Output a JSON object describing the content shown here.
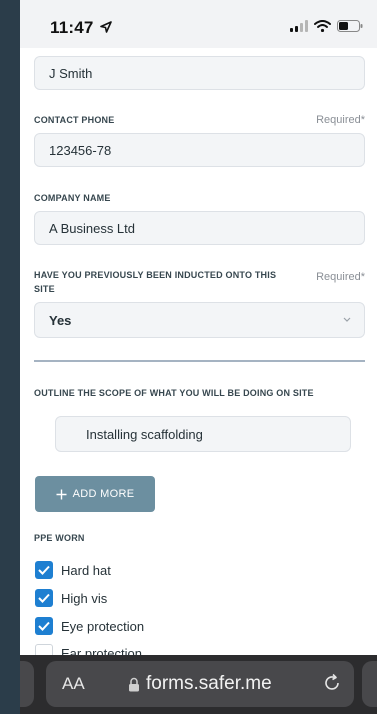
{
  "status_bar": {
    "time": "11:47"
  },
  "form": {
    "name_value": "J Smith",
    "contact_phone": {
      "label": "CONTACT PHONE",
      "required": "Required*",
      "value": "123456-78"
    },
    "company_name": {
      "label": "COMPANY NAME",
      "value": "A Business Ltd"
    },
    "inducted": {
      "label_line1": "HAVE YOU PREVIOUSLY BEEN INDUCTED ONTO THIS",
      "label_line2": "SITE",
      "required": "Required*",
      "value": "Yes"
    },
    "scope": {
      "label": "OUTLINE THE SCOPE OF WHAT YOU WILL BE DOING ON SITE",
      "value": "Installing scaffolding"
    },
    "add_more_label": "ADD MORE",
    "ppe": {
      "label": "PPE WORN",
      "items": [
        {
          "label": "Hard hat",
          "checked": true
        },
        {
          "label": "High vis",
          "checked": true
        },
        {
          "label": "Eye protection",
          "checked": true
        },
        {
          "label": "Ear protection",
          "checked": false
        }
      ]
    }
  },
  "browser": {
    "aa_label": "AA",
    "url": "forms.safer.me"
  },
  "colors": {
    "accent": "#1e7fd1",
    "button": "#6c8fa0",
    "browser_bar": "#2c2c2e"
  },
  "icons": [
    "location-arrow-icon",
    "signal-icon",
    "wifi-icon",
    "battery-icon",
    "chevron-down-icon",
    "plus-icon",
    "check-icon",
    "lock-icon",
    "reload-icon"
  ]
}
